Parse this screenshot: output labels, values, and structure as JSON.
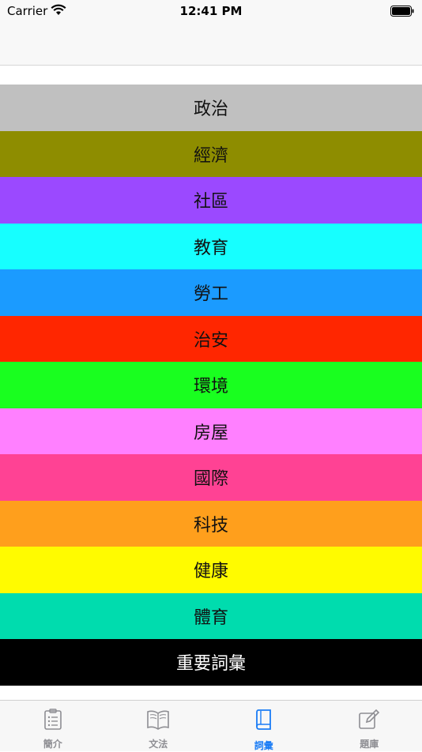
{
  "status_bar": {
    "carrier": "Carrier",
    "time": "12:41 PM"
  },
  "categories": [
    {
      "label": "政治",
      "color": "#c0c0c0",
      "text_color": "#111111"
    },
    {
      "label": "經濟",
      "color": "#8e8d00",
      "text_color": "#111111"
    },
    {
      "label": "社區",
      "color": "#9b49ff",
      "text_color": "#111111"
    },
    {
      "label": "教育",
      "color": "#16ffff",
      "text_color": "#111111"
    },
    {
      "label": "勞工",
      "color": "#1b9bff",
      "text_color": "#111111"
    },
    {
      "label": "治安",
      "color": "#ff2600",
      "text_color": "#111111"
    },
    {
      "label": "環境",
      "color": "#19ff1f",
      "text_color": "#111111"
    },
    {
      "label": "房屋",
      "color": "#ff80ff",
      "text_color": "#111111"
    },
    {
      "label": "國際",
      "color": "#ff4294",
      "text_color": "#111111"
    },
    {
      "label": "科技",
      "color": "#ff9f1c",
      "text_color": "#111111"
    },
    {
      "label": "健康",
      "color": "#fffb00",
      "text_color": "#111111"
    },
    {
      "label": "體育",
      "color": "#00dcae",
      "text_color": "#111111"
    },
    {
      "label": "重要詞彙",
      "color": "#000000",
      "text_color": "#ffffff"
    }
  ],
  "tab_bar": {
    "items": [
      {
        "label": "簡介",
        "icon": "list-icon",
        "active": false
      },
      {
        "label": "文法",
        "icon": "open-book-icon",
        "active": false
      },
      {
        "label": "詞彙",
        "icon": "book-icon",
        "active": true
      },
      {
        "label": "題庫",
        "icon": "edit-icon",
        "active": false
      }
    ],
    "active_color": "#1a7cf5",
    "inactive_color": "#8e8e93"
  }
}
